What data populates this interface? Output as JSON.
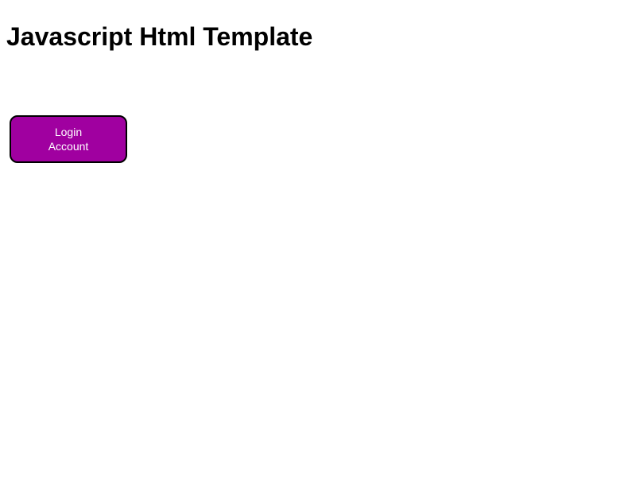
{
  "heading": "Javascript Html Template",
  "button": {
    "line1": "Login",
    "line2": "Account"
  }
}
